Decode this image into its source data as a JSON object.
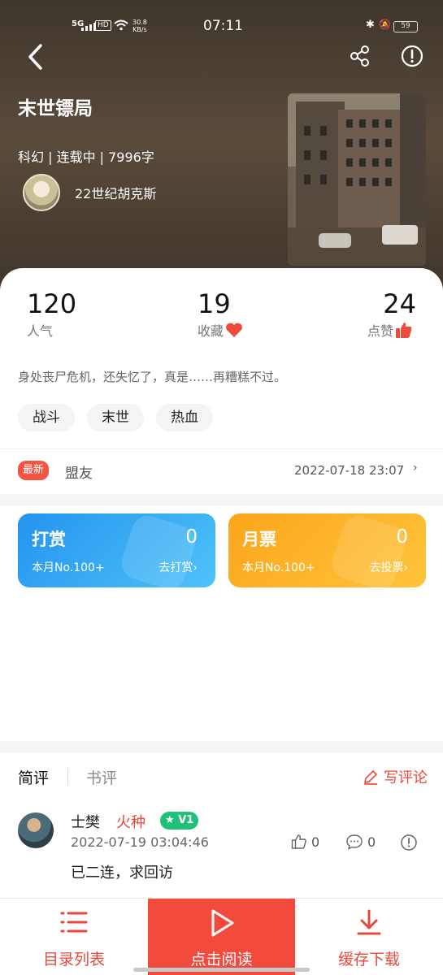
{
  "status_bar": {
    "network": "5G",
    "hd": "HD",
    "speed": "30.8",
    "speed_unit": "KB/s",
    "time": "07:11",
    "battery": "59"
  },
  "book": {
    "title": "末世镖局",
    "meta": "科幻 | 连载中 | 7996字",
    "author": "22世纪胡克斯",
    "description": "身处丧尸危机，还失忆了，真是……再糟糕不过。",
    "tags": [
      "战斗",
      "末世",
      "热血"
    ]
  },
  "stats": {
    "popularity": {
      "value": "120",
      "label": "人气"
    },
    "favorites": {
      "value": "19",
      "label": "收藏"
    },
    "likes": {
      "value": "24",
      "label": "点赞"
    }
  },
  "latest": {
    "badge": "最新",
    "chapter": "盟友",
    "date": "2022-07-18 23:07"
  },
  "reward": {
    "title": "打赏",
    "count": "0",
    "rank": "本月No.100+",
    "action": "去打赏",
    "color": "#2fa6f0"
  },
  "ticket": {
    "title": "月票",
    "count": "0",
    "rank": "本月No.100+",
    "action": "去投票",
    "color": "#fdb020"
  },
  "reviews": {
    "tab_short": "简评",
    "tab_book": "书评",
    "write": "写评论"
  },
  "comment": {
    "user": "士樊",
    "level": "火种",
    "vip": "V1",
    "time": "2022-07-19 03:04:46",
    "text": "已二连，求回访",
    "likes": "0",
    "replies": "0"
  },
  "bottom_nav": {
    "catalog": "目录列表",
    "read": "点击阅读",
    "download": "缓存下载"
  },
  "colors": {
    "accent": "#e8483b",
    "read_button": "#f24b3e"
  }
}
